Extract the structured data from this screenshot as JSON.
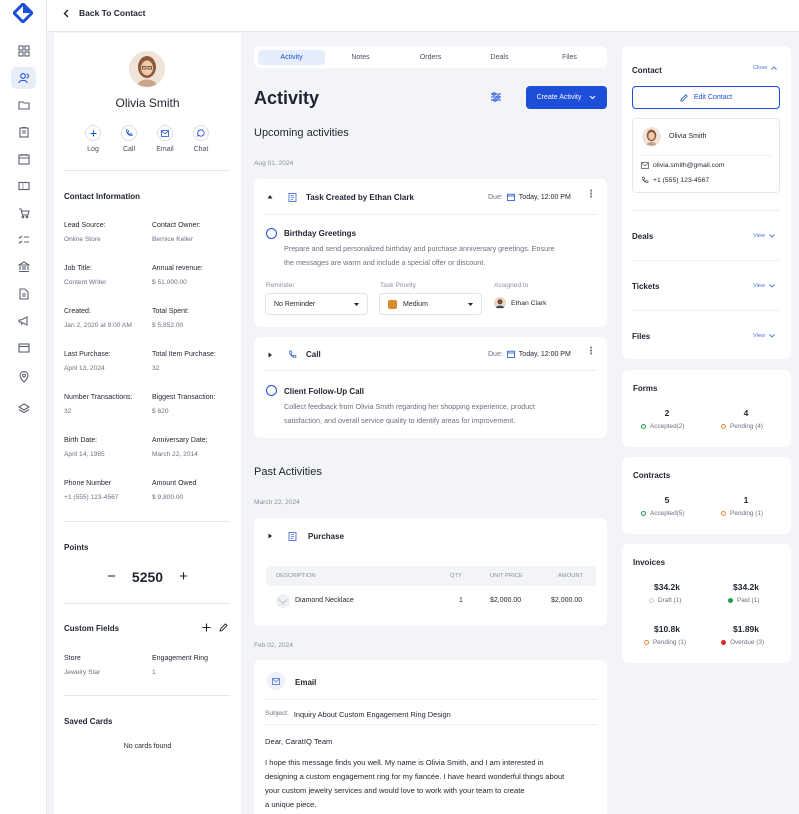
{
  "nav": {
    "back_label": "Back To Contact"
  },
  "contact": {
    "name": "Olivia Smith",
    "email": "olivia.smith@gmail.com",
    "phone": "+1 (555) 123-4567",
    "quick_actions": [
      "Log",
      "Call",
      "Email",
      "Chat"
    ]
  },
  "contact_info": {
    "title": "Contact Information",
    "fields": [
      {
        "label": "Lead Source:",
        "value": "Online Store"
      },
      {
        "label": "Contact Owner:",
        "value": "Bernice Keller"
      },
      {
        "label": "Job Title:",
        "value": "Content Writer"
      },
      {
        "label": "Annual revenue:",
        "value": "$ 51,000.00"
      },
      {
        "label": "Created:",
        "value": "Jan 2, 2020 at 9:00 AM"
      },
      {
        "label": "Total Spent:",
        "value": "$ 5,852.00"
      },
      {
        "label": "Last Purchase:",
        "value": "April 13, 2024"
      },
      {
        "label": "Total Item Purchase:",
        "value": "32"
      },
      {
        "label": "Number Transactions:",
        "value": "32"
      },
      {
        "label": "Biggest Transaction:",
        "value": "$ 620"
      },
      {
        "label": "Birth Date:",
        "value": "April 14, 1985"
      },
      {
        "label": "Anniversary Date:",
        "value": "March 22, 2014"
      },
      {
        "label": "Phone Number",
        "value": "+1 (555) 123-4567"
      },
      {
        "label": "Amount Owed",
        "value": "$ 9,800.00"
      }
    ]
  },
  "points": {
    "title": "Points",
    "value": "5250",
    "minus": "−",
    "plus": "+"
  },
  "custom_fields": {
    "title": "Custom Fields",
    "fields": [
      {
        "label": "Store",
        "value": "Jewelry Star"
      },
      {
        "label": "Engagement Ring",
        "value": "1"
      }
    ]
  },
  "saved_cards": {
    "title": "Saved Cards",
    "empty": "No cards found"
  },
  "tabs": [
    "Activity",
    "Notes",
    "Orders",
    "Deals",
    "Files"
  ],
  "activity": {
    "title": "Activity",
    "create_label": "Create Activity",
    "upcoming_title": "Upcoming activities",
    "upcoming_date": "Aug 01, 2024",
    "task": {
      "header": "Task Created by Ethan Clark",
      "due_label": "Due:",
      "due_value": "Today, 12:00 PM",
      "title": "Birthday Greetings",
      "desc_line1": "Prepare and send personalized birthday and purchase anniversary greetings. Ensure",
      "desc_line2": "the messages are warm and include a special offer or discount.",
      "reminder_label": "Reminder",
      "reminder_value": "No Reminder",
      "priority_label": "Task Priority",
      "priority_value": "Medium",
      "assigned_label": "Assigned to",
      "assigned_value": "Ethan Clark"
    },
    "call": {
      "header": "Call",
      "due_label": "Due:",
      "due_value": "Today, 12:00 PM",
      "title": "Client Follow-Up Call",
      "desc_line1": "Collect feedback from Olivia Smith regarding her shopping experience, product",
      "desc_line2": "satisfaction, and overall service quality to identify areas for improvement."
    },
    "past_title": "Past Activities",
    "past_date1": "March 22, 2024",
    "purchase": {
      "header": "Purchase",
      "columns": [
        "DESCRIPTION",
        "QTY",
        "UNIT PRICE",
        "AMOUNT"
      ],
      "rows": [
        {
          "description": "Diamond Necklace",
          "qty": "1",
          "unit_price": "$2,000.00",
          "amount": "$2,000.00"
        }
      ]
    },
    "past_date2": "Feb 02, 2024",
    "email": {
      "header": "Email",
      "subject_label": "Subject:",
      "subject": "Inquiry About Custom Engagement Ring Design",
      "greeting": "Dear, CaratIQ Team",
      "body_line1": "I hope this message finds you well. My name is Olivia Smith, and I am interested in",
      "body_line2": "designing a custom engagement ring for my fiancée. I have heard wonderful things about",
      "body_line3": "your custom jewelry services and would love to work with your team to create",
      "body_line4": "a unique piece."
    }
  },
  "right": {
    "contact_title": "Contact",
    "close_label": "Close",
    "edit_label": "Edit Contact",
    "deals_title": "Deals",
    "tickets_title": "Tickets",
    "files_title": "Files",
    "view_label": "View",
    "forms": {
      "title": "Forms",
      "items": [
        {
          "num": "2",
          "label": "Accepted(2)"
        },
        {
          "num": "4",
          "label": "Pending (4)"
        }
      ]
    },
    "contracts": {
      "title": "Contracts",
      "items": [
        {
          "num": "5",
          "label": "Accepted(5)"
        },
        {
          "num": "1",
          "label": "Pending (1)"
        }
      ]
    },
    "invoices": {
      "title": "Invoices",
      "items": [
        {
          "num": "$34.2k",
          "label": "Draft (1)"
        },
        {
          "num": "$34.2k",
          "label": "Paid (1)"
        },
        {
          "num": "$10.8k",
          "label": "Pending (1)"
        },
        {
          "num": "$1.89k",
          "label": "Overdue (3)"
        }
      ]
    }
  },
  "colors": {
    "accent": "#1d4ed8",
    "green": "#16a34a",
    "orange": "#ea8a2e",
    "red": "#dc2626"
  }
}
